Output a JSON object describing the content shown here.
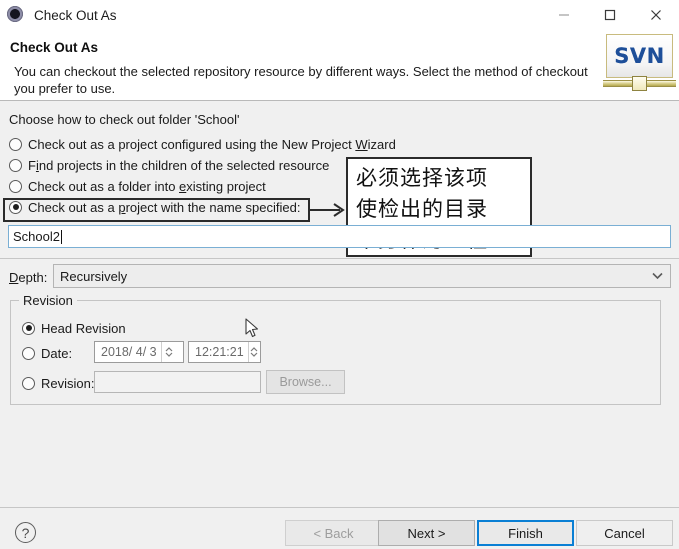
{
  "window": {
    "title": "Check Out As",
    "icon": "svn-app-icon",
    "controls": [
      {
        "name": "minimize",
        "glyph": "minimize-icon"
      },
      {
        "name": "maximize",
        "glyph": "maximize-icon"
      },
      {
        "name": "close",
        "glyph": "close-icon"
      }
    ]
  },
  "header": {
    "title": "Check Out As",
    "description": "You can checkout the selected repository resource by different ways. Select the method of checkout you prefer to use.",
    "logo_text": "SVN"
  },
  "main": {
    "choose_label": "Choose how to check out folder 'School'",
    "options": [
      {
        "label_pre": "Check out as a project configured using the New Project ",
        "mnemonic": "W",
        "label_post": "izard",
        "checked": false
      },
      {
        "label_pre": "F",
        "mnemonic": "i",
        "label_post": "nd projects in the children of the selected resource",
        "checked": false
      },
      {
        "label_pre": "Check out as a folder into ",
        "mnemonic": "e",
        "label_post": "xisting project",
        "checked": false
      },
      {
        "label_pre": "Check out as a ",
        "mnemonic": "p",
        "label_post": "roject with the name specified:",
        "checked": true
      }
    ],
    "name_input": {
      "value": "School2",
      "placeholder": ""
    },
    "depth": {
      "label_pre": "D",
      "mnemonic": "",
      "label_post": "epth:",
      "label": "Depth:",
      "value": "Recursively"
    }
  },
  "annotation": {
    "line1": "必须选择该项",
    "line2": "使检出的目录",
    "line3": "本身作为工程"
  },
  "revision": {
    "group_title": "Revision",
    "head_label": "Head Revision",
    "head_checked": true,
    "date_label": "Date:",
    "date_value": "2018/ 4/ 3",
    "time_value": "12:21:21",
    "revision_label": "Revision:",
    "revision_value": "",
    "browse_label": "Browse..."
  },
  "footer": {
    "help_glyph": "?",
    "buttons": [
      {
        "label": "< Back",
        "name": "back-button",
        "state": "disabled"
      },
      {
        "label": "Next >",
        "name": "next-button",
        "state": "enabled"
      },
      {
        "label": "Finish",
        "name": "finish-button",
        "state": "focused"
      },
      {
        "label": "Cancel",
        "name": "cancel-button",
        "state": "enabled"
      }
    ]
  },
  "colors": {
    "window_bg": "#f0f0f0",
    "header_bg": "#ffffff",
    "focus_blue": "#0a7fd4",
    "input_border_blue": "#7aafd4",
    "svn_blue": "#1e4f99",
    "annotation_border": "#2b2b2b"
  }
}
